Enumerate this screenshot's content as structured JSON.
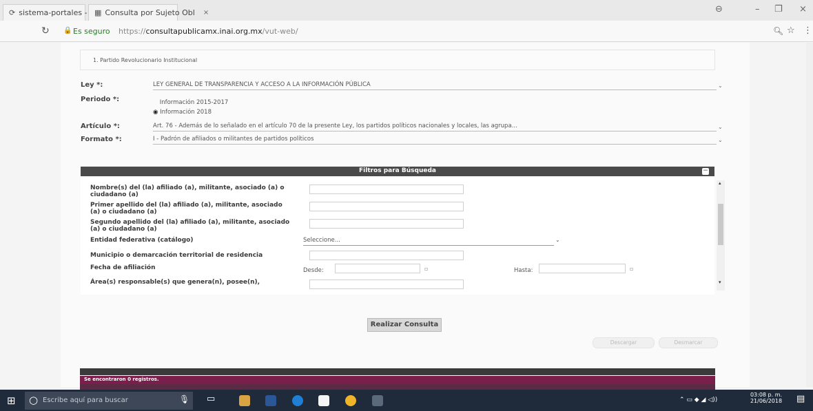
{
  "browser": {
    "tabs": [
      {
        "label": "sistema-portales - PNT"
      },
      {
        "label": "Consulta por Sujeto Obl"
      }
    ],
    "secure_label": "Es seguro",
    "url_prefix": "https://",
    "url_host": "consultapublicamx.inai.org.mx",
    "url_path": "/vut-web/"
  },
  "form": {
    "sujeto": "1. Partido Revolucionario Institucional",
    "ley_label": "Ley *:",
    "ley_value": "LEY GENERAL DE TRANSPARENCIA Y ACCESO A LA INFORMACIÓN PÚBLICA",
    "periodo_label": "Periodo *:",
    "periodo_options": [
      "Información 2015-2017",
      "Información 2018"
    ],
    "articulo_label": "Artículo *:",
    "articulo_value": "Art. 76 - Además de lo señalado en el artículo 70 de la presente Ley, los partidos políticos nacionales y locales, las agrupa...",
    "formato_label": "Formato *:",
    "formato_value": "I - Padrón de afiliados o militantes de partidos políticos"
  },
  "filters": {
    "title": "Filtros para Búsqueda",
    "fields": [
      {
        "label": "Nombre(s) del (la) afiliado (a), militante, asociado (a) o ciudadano (a)"
      },
      {
        "label": "Primer apellido del (la) afiliado (a), militante, asociado (a) o ciudadano (a)"
      },
      {
        "label": "Segundo apellido del (la) afiliado (a), militante, asociado (a) o ciudadano (a)"
      },
      {
        "label": "Entidad federativa (catálogo)"
      },
      {
        "label": "Municipio o demarcación territorial de residencia"
      },
      {
        "label": "Fecha de afiliación"
      },
      {
        "label": "Área(s) responsable(s) que genera(n), posee(n),"
      }
    ],
    "entidad_select": "Seleccione...",
    "desde_label": "Desde:",
    "hasta_label": "Hasta:"
  },
  "actions": {
    "consultar": "Realizar Consulta",
    "descargar": "Descargar",
    "desmarcar": "Desmarcar"
  },
  "results": {
    "count_text": "Se encontraron 0 registros."
  },
  "taskbar": {
    "search_placeholder": "Escribe aquí para buscar",
    "time": "03:08 p. m.",
    "date": "21/06/2018"
  },
  "colors": {
    "panel_header": "#4a4a4a",
    "results_bar": "#7a1f4c",
    "taskbar": "#1f2a3a"
  }
}
